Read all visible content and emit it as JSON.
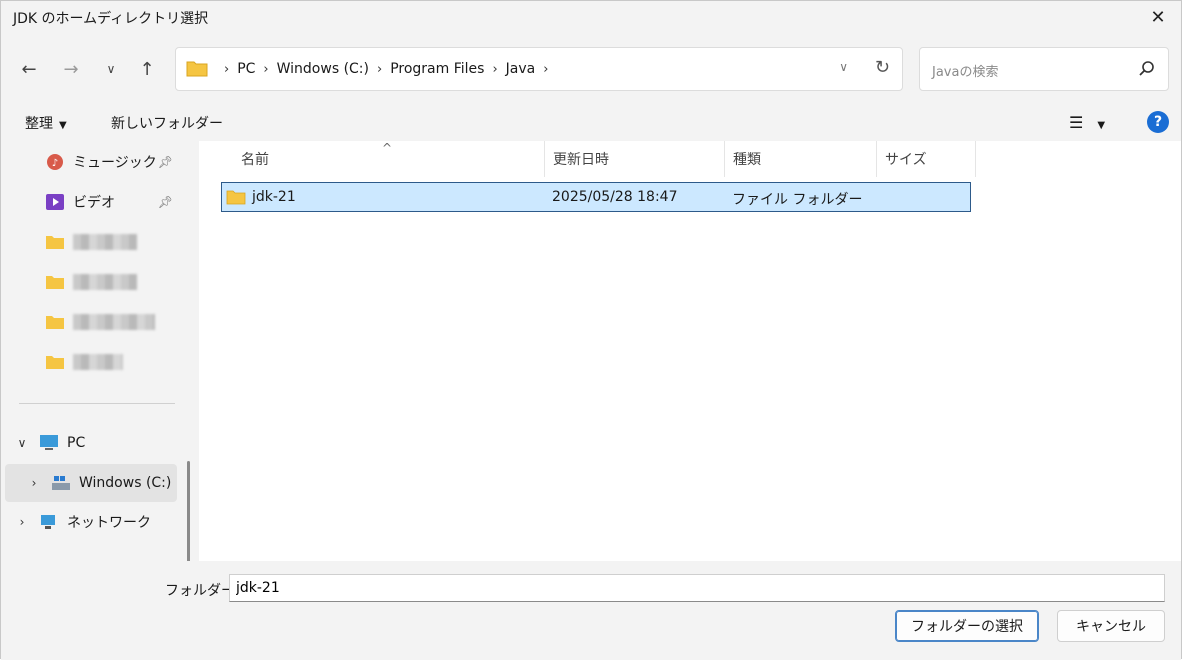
{
  "window": {
    "title": "JDK のホームディレクトリ選択"
  },
  "nav": {
    "address_crumbs": [
      "PC",
      "Windows (C:)",
      "Program Files",
      "Java"
    ],
    "search_placeholder": "Javaの検索"
  },
  "commandbar": {
    "organize": "整理",
    "new_folder": "新しいフォルダー"
  },
  "sidebar": {
    "quick_access": [
      {
        "label": "ミュージック",
        "icon": "music-icon"
      },
      {
        "label": "ビデオ",
        "icon": "video-icon"
      }
    ],
    "pc": "PC",
    "windows_drive": "Windows (C:)",
    "network": "ネットワーク"
  },
  "columns": {
    "name": "名前",
    "modified": "更新日時",
    "type": "種類",
    "size": "サイズ"
  },
  "files": [
    {
      "name": "jdk-21",
      "modified": "2025/05/28 18:47",
      "type": "ファイル フォルダー",
      "size": ""
    }
  ],
  "bottom": {
    "folder_label": "フォルダー:",
    "folder_value": "jdk-21",
    "select_button": "フォルダーの選択",
    "cancel_button": "キャンセル"
  },
  "colors": {
    "selection": "#cce8ff",
    "accent": "#1a6dd4",
    "folder": "#f5c542"
  }
}
